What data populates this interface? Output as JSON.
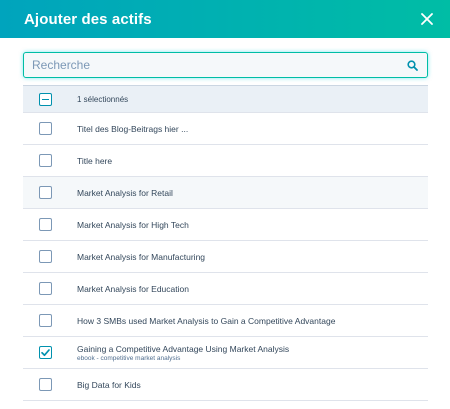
{
  "modal": {
    "title": "Ajouter des actifs",
    "close_icon": "close-icon"
  },
  "search": {
    "placeholder": "Recherche",
    "value": "",
    "icon": "search-icon"
  },
  "colors": {
    "header_start": "#00a4bd",
    "header_end": "#00bda5",
    "checkbox_accent": "#0091ae"
  },
  "table": {
    "header_label": "1 sélectionnés",
    "header_state": "indeterminate",
    "rows": [
      {
        "label": "Titel des Blog-Beitrags hier ...",
        "sub": "",
        "checked": false
      },
      {
        "label": "Title here",
        "sub": "",
        "checked": false
      },
      {
        "label": "Market Analysis for Retail",
        "sub": "",
        "checked": false
      },
      {
        "label": "Market Analysis for High Tech",
        "sub": "",
        "checked": false
      },
      {
        "label": "Market Analysis for Manufacturing",
        "sub": "",
        "checked": false
      },
      {
        "label": "Market Analysis for Education",
        "sub": "",
        "checked": false
      },
      {
        "label": "How 3 SMBs used Market Analysis to Gain a Competitive Advantage",
        "sub": "",
        "checked": false
      },
      {
        "label": "Gaining a Competitive Advantage Using Market Analysis",
        "sub": "ebook - competitive market analysis",
        "checked": true
      },
      {
        "label": "Big Data for Kids",
        "sub": "",
        "checked": false
      }
    ]
  }
}
